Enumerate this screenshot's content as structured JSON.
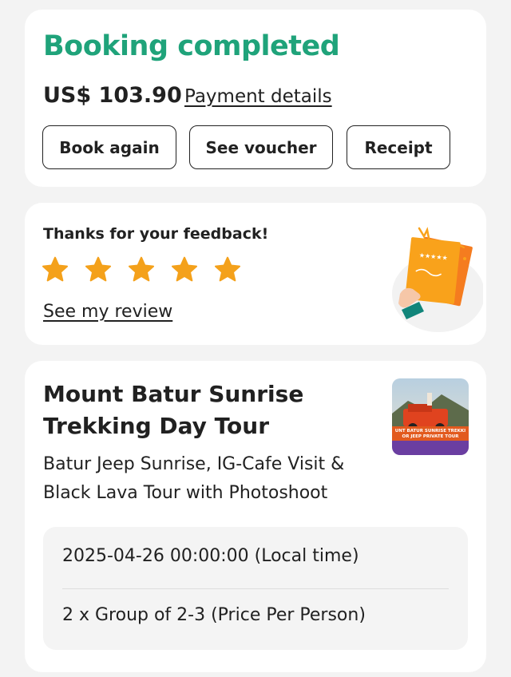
{
  "status": {
    "title": "Booking completed",
    "price": "US$ 103.90",
    "payment_link": "Payment details",
    "buttons": {
      "book_again": "Book again",
      "see_voucher": "See voucher",
      "receipt": "Receipt"
    }
  },
  "feedback": {
    "title": "Thanks for your feedback!",
    "rating": 5,
    "rating_max": 5,
    "review_link": "See my review",
    "star_color": "#f4a11b",
    "illustration_stars": "★★★★★"
  },
  "tour": {
    "title": "Mount Batur Sunrise Trekking Day Tour",
    "subtitle": "Batur Jeep Sunrise, IG-Cafe Visit & Black Lava Tour with Photoshoot",
    "thumbnail_text": "UNT BATUR SUNRISE TREKKI OR JEEP PRIVATE TOUR",
    "details": {
      "datetime": "2025-04-26 00:00:00 (Local time)",
      "package": "2 x Group of 2-3 (Price Per Person)"
    }
  },
  "colors": {
    "accent_green": "#1fa37a",
    "text": "#212121",
    "background": "#f3f3f3"
  }
}
